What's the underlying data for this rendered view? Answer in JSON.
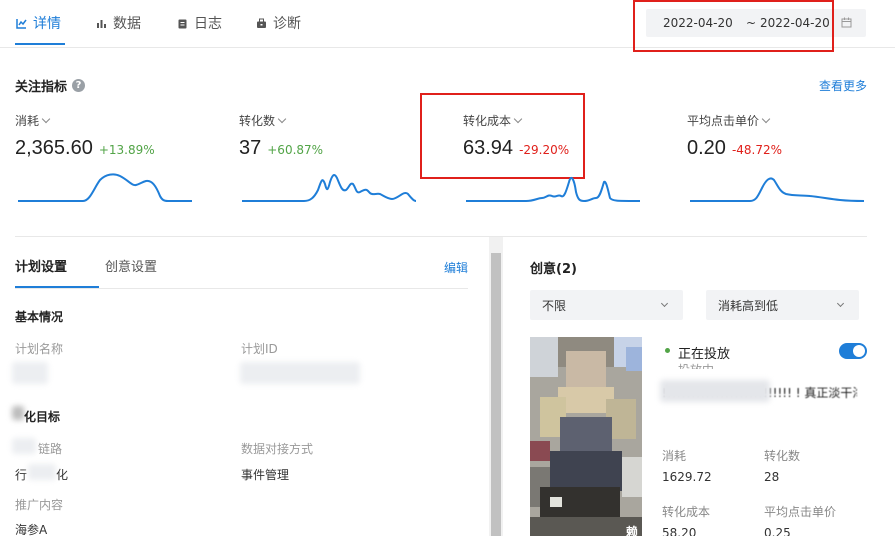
{
  "tabs": [
    {
      "label": "详情",
      "icon": "chart-line-icon",
      "active": true
    },
    {
      "label": "数据",
      "icon": "bar-chart-icon",
      "active": false
    },
    {
      "label": "日志",
      "icon": "clipboard-icon",
      "active": false
    },
    {
      "label": "诊断",
      "icon": "toolbox-icon",
      "active": false
    }
  ],
  "date_range": {
    "start": "2022-04-20",
    "separator": "~",
    "end": "2022-04-20",
    "icon": "calendar-icon"
  },
  "indicators": {
    "title": "关注指标",
    "help_icon": "question-icon",
    "more_link": "查看更多",
    "metrics": [
      {
        "label": "消耗",
        "value": "2,365.60",
        "delta": "+13.89%",
        "trend": "up"
      },
      {
        "label": "转化数",
        "value": "37",
        "delta": "+60.87%",
        "trend": "up"
      },
      {
        "label": "转化成本",
        "value": "63.94",
        "delta": "-29.20%",
        "trend": "down"
      },
      {
        "label": "平均点击单价",
        "value": "0.20",
        "delta": "-48.72%",
        "trend": "down"
      }
    ]
  },
  "left_panel": {
    "tabs": [
      "计划设置",
      "创意设置"
    ],
    "edit_link": "编辑",
    "basic": {
      "title": "基本情况",
      "plan_name_label": "计划名称",
      "plan_id_label": "计划ID"
    },
    "optimization": {
      "title": "化目标",
      "link_label": "链路",
      "link_value": "行",
      "link_value_tail": "化",
      "connect_label": "数据对接方式",
      "connect_value": "事件管理",
      "content_label": "推广内容",
      "content_value": "海参A"
    }
  },
  "right_panel": {
    "title": "创意(2)",
    "filter_select": "不限",
    "sort_select": "消耗高到低",
    "creative": {
      "status": "正在投放",
      "status_sub": "投放中",
      "title": "!!!!!!!!!!!!!!!!!!!!!!!!!!!  ! 真正淡干海参",
      "stats": [
        {
          "label": "消耗",
          "value": "1629.72"
        },
        {
          "label": "转化数",
          "value": "28"
        },
        {
          "label": "转化成本",
          "value": "58.20"
        },
        {
          "label": "平均点击单价",
          "value": "0.25"
        }
      ],
      "thumb_overlay": "赖"
    }
  },
  "colors": {
    "accent": "#1f7ed8",
    "positive": "#52a447",
    "negative": "#e0201b",
    "highlight_box": "#e0201b"
  }
}
